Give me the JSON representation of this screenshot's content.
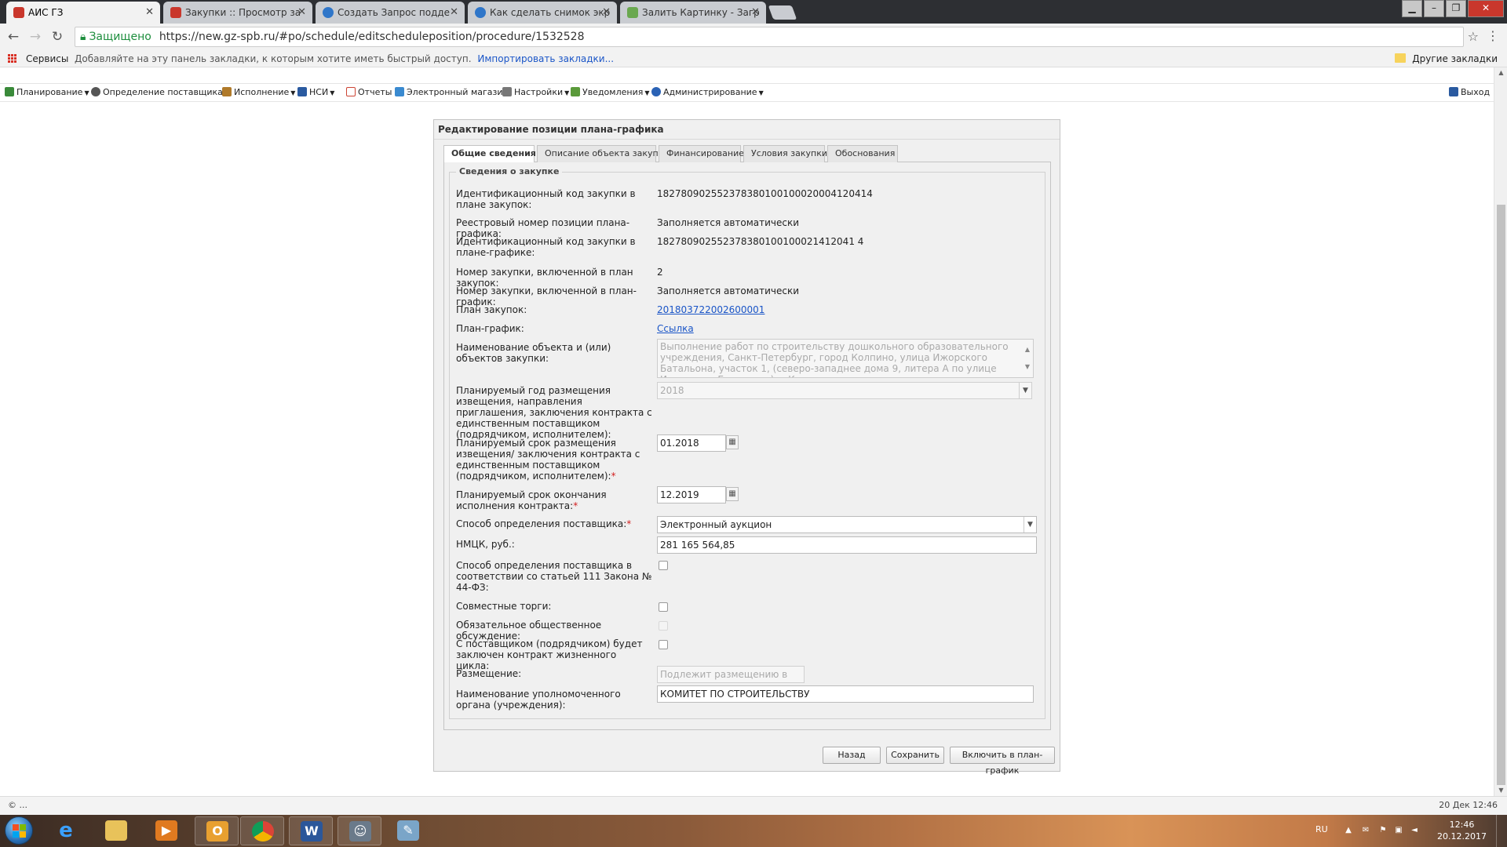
{
  "browser": {
    "tabs": [
      {
        "title": "АИС ГЗ",
        "active": true
      },
      {
        "title": "Закупки :: Просмотр за"
      },
      {
        "title": "Создать Запрос подде"
      },
      {
        "title": "Как сделать снимок экр"
      },
      {
        "title": "Залить Картинку - Загр"
      }
    ],
    "secure_label": "Защищено",
    "url": "https://new.gz-spb.ru/#po/schedule/editscheduleposition/procedure/1532528",
    "bookmarks": {
      "services": "Сервисы",
      "hint": "Добавляйте на эту панель закладки, к которым хотите иметь быстрый доступ.",
      "import": "Импортировать закладки...",
      "other": "Другие закладки"
    }
  },
  "app_menu": {
    "items": [
      {
        "label": "Планирование",
        "caret": true,
        "icon": "planning-icon"
      },
      {
        "label": "Определение поставщика",
        "caret": true,
        "icon": "supplier-icon"
      },
      {
        "label": "Исполнение",
        "caret": true,
        "icon": "execution-icon"
      },
      {
        "label": "НСИ",
        "caret": true,
        "icon": "reference-icon"
      },
      {
        "label": "Отчеты",
        "caret": false,
        "icon": "reports-icon"
      },
      {
        "label": "Электронный магазин",
        "caret": false,
        "icon": "shop-icon"
      },
      {
        "label": "Настройки",
        "caret": true,
        "icon": "settings-icon"
      },
      {
        "label": "Уведомления",
        "caret": true,
        "icon": "notifications-icon"
      },
      {
        "label": "Администрирование",
        "caret": true,
        "icon": "admin-icon"
      }
    ],
    "logout": "Выход"
  },
  "panel": {
    "title": "Редактирование позиции плана-графика",
    "tabs": [
      "Общие сведения",
      "Описание объекта закупки",
      "Финансирование",
      "Условия закупки",
      "Обоснования"
    ],
    "legend": "Сведения о закупке",
    "fields": {
      "ikz_plan_label": "Идентификационный код закупки в плане закупок:",
      "ikz_plan_value": "182780902552378380100100020004120414",
      "registry_label": "Реестровый номер позиции плана-графика:",
      "registry_value": "Заполняется автоматически",
      "ikz_schedule_label": "Идентификационный код закупки в плане-графике:",
      "ikz_schedule_value": "182780902552378380100100021412041 4",
      "num_plan_label": "Номер закупки, включенной в план закупок:",
      "num_plan_value": "2",
      "num_schedule_label": "Номер закупки, включенной в план-график:",
      "num_schedule_value": "Заполняется автоматически",
      "plan_label": "План закупок:",
      "plan_value": "201803722002600001",
      "schedule_label": "План-график:",
      "schedule_value": "Ссылка",
      "object_name_label": "Наименование объекта и (или) объектов закупки:",
      "object_name_value": "Выполнение работ по строительству дошкольного образовательного учреждения, Санкт-Петербург, город Колпино, улица Ижорского Батальона, участок 1, (северо-западнее дома 9, литера А по улице Ижорского Батальона); г.Колпино,",
      "year_label": "Планируемый год размещения извещения, направления приглашения, заключения контракта с единственным поставщиком (подрядчиком, исполнителем):",
      "year_value": "2018",
      "placement_term_label": "Планируемый срок размещения извещения/ заключения контракта с единственным поставщиком (подрядчиком, исполнителем):",
      "placement_term_value": "01.2018",
      "end_term_label": "Планируемый срок окончания исполнения контракта:",
      "end_term_value": "12.2019",
      "method_label": "Способ определения поставщика:",
      "method_value": "Электронный аукцион",
      "nmck_label": "НМЦК, руб.:",
      "nmck_value": "281 165 564,85",
      "art111_label": "Способ определения поставщика в соответствии со статьей 111 Закона № 44-ФЗ:",
      "joint_label": "Совместные торги:",
      "discussion_label": "Обязательное общественное обсуждение:",
      "lifecycle_label": "С поставщиком (подрядчиком) будет заключен контракт жизненного цикла:",
      "placement_label": "Размещение:",
      "placement_value": "Подлежит размещению в УпО",
      "authority_label": "Наименование уполномоченного органа (учреждения):",
      "authority_value": "КОМИТЕТ ПО СТРОИТЕЛЬСТВУ"
    },
    "buttons": {
      "back": "Назад",
      "save": "Сохранить",
      "include": "Включить в план-график"
    }
  },
  "statusbar": {
    "left": "© ...",
    "right": "20 Дек 12:46"
  },
  "taskbar": {
    "lang": "RU",
    "time": "12:46",
    "date": "20.12.2017"
  }
}
